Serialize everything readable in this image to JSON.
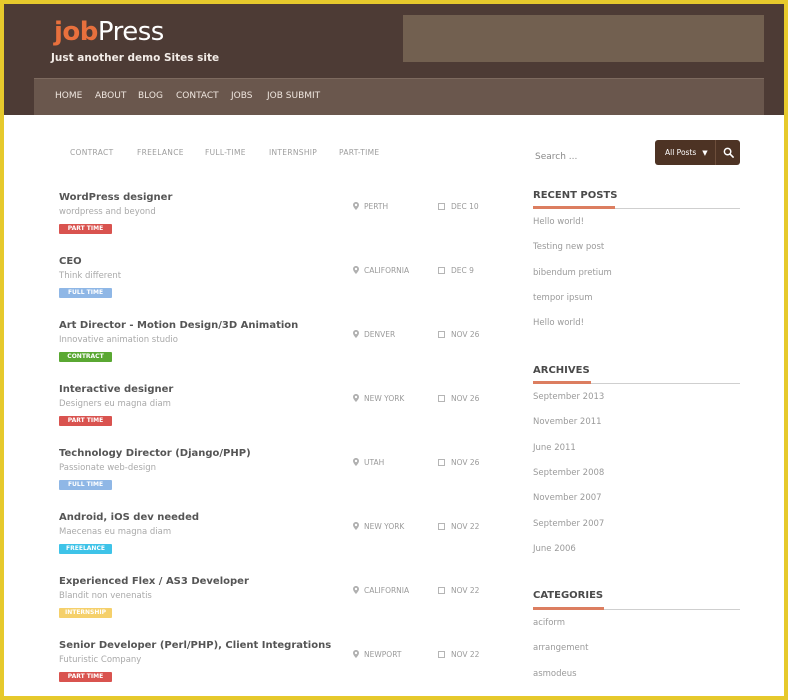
{
  "site": {
    "logo_part1": "job",
    "logo_part2": "Press",
    "tagline": "Just another demo Sites site"
  },
  "nav": [
    "HOME",
    "ABOUT",
    "BLOG",
    "CONTACT",
    "JOBS",
    "JOB SUBMIT"
  ],
  "filters": [
    "CONTRACT",
    "FREELANCE",
    "FULL-TIME",
    "INTERNSHIP",
    "PART-TIME"
  ],
  "search": {
    "placeholder": "Search ...",
    "select_value": "All Posts"
  },
  "colors": {
    "header": "#4d3b35",
    "navbar": "#6a574d",
    "accent": "#e8703d",
    "part_time": "#d9534f",
    "full_time": "#8fb7e6",
    "contract": "#5aa832",
    "freelance": "#3ec3e8",
    "internship": "#f5d06b"
  },
  "jobs": [
    {
      "title": "WordPress designer",
      "subtitle": "wordpress and beyond",
      "type": "PART TIME",
      "type_color": "#d9534f",
      "location": "PERTH",
      "date": "DEC 10"
    },
    {
      "title": "CEO",
      "subtitle": "Think different",
      "type": "FULL TIME",
      "type_color": "#8fb7e6",
      "location": "CALIFORNIA",
      "date": "DEC 9"
    },
    {
      "title": "Art Director - Motion Design/3D Animation",
      "subtitle": "Innovative animation studio",
      "type": "CONTRACT",
      "type_color": "#5aa832",
      "location": "DENVER",
      "date": "NOV 26"
    },
    {
      "title": "Interactive designer",
      "subtitle": "Designers eu magna diam",
      "type": "PART TIME",
      "type_color": "#d9534f",
      "location": "NEW YORK",
      "date": "NOV 26"
    },
    {
      "title": "Technology Director (Django/PHP)",
      "subtitle": "Passionate web-design",
      "type": "FULL TIME",
      "type_color": "#8fb7e6",
      "location": "UTAH",
      "date": "NOV 26"
    },
    {
      "title": "Android, iOS dev needed",
      "subtitle": "Maecenas eu magna diam",
      "type": "FREELANCE",
      "type_color": "#3ec3e8",
      "location": "NEW YORK",
      "date": "NOV 22"
    },
    {
      "title": "Experienced Flex / AS3 Developer",
      "subtitle": "Blandit non venenatis",
      "type": "INTERNSHIP",
      "type_color": "#f5d06b",
      "location": "CALIFORNIA",
      "date": "NOV 22"
    },
    {
      "title": "Senior Developer (Perl/PHP), Client Integrations",
      "subtitle": "Futuristic Company",
      "type": "PART TIME",
      "type_color": "#d9534f",
      "location": "NEWPORT",
      "date": "NOV 22"
    }
  ],
  "sidebar": {
    "recent_posts": {
      "title": "RECENT POSTS",
      "items": [
        "Hello world!",
        "Testing new post",
        "bibendum pretium",
        "tempor ipsum",
        "Hello world!"
      ]
    },
    "archives": {
      "title": "ARCHIVES",
      "items": [
        "September 2013",
        "November 2011",
        "June 2011",
        "September 2008",
        "November 2007",
        "September 2007",
        "June 2006"
      ]
    },
    "categories": {
      "title": "CATEGORIES",
      "items": [
        "aciform",
        "arrangement",
        "asmodeus"
      ]
    }
  }
}
